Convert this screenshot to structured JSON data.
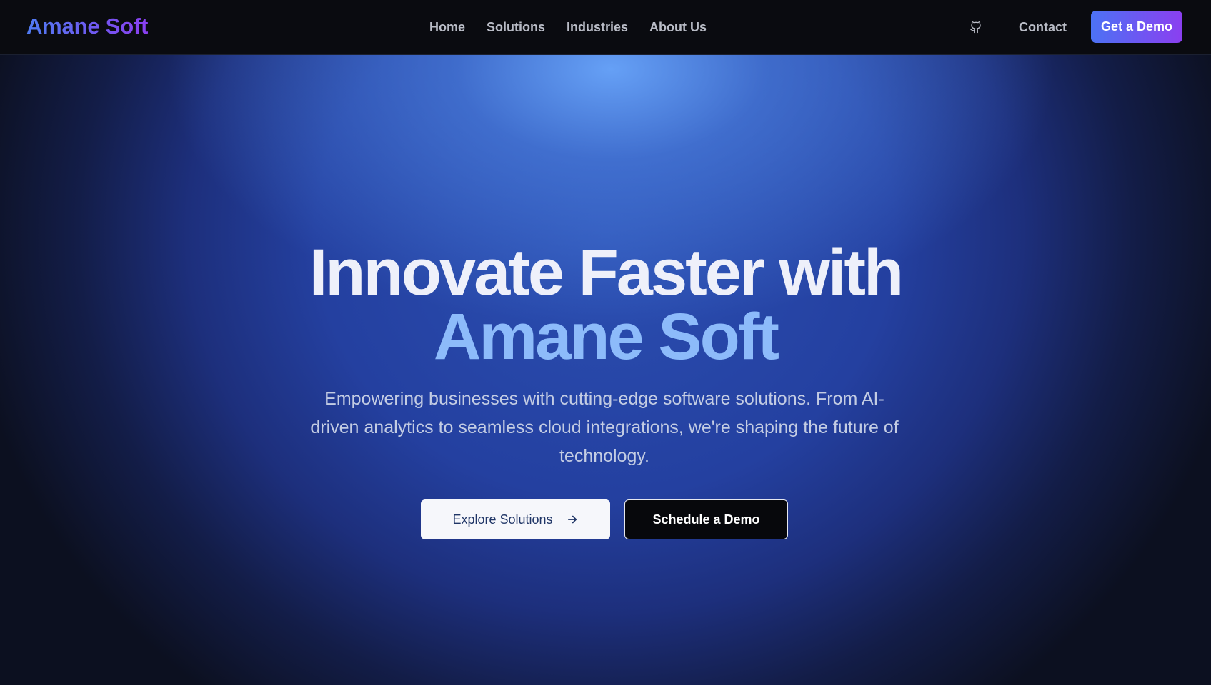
{
  "header": {
    "brand": "Amane Soft",
    "nav": [
      {
        "label": "Home"
      },
      {
        "label": "Solutions"
      },
      {
        "label": "Industries"
      },
      {
        "label": "About Us"
      }
    ],
    "github_icon": "github-icon",
    "contact_label": "Contact",
    "demo_button_label": "Get a Demo"
  },
  "hero": {
    "headline_line1": "Innovate Faster with",
    "headline_line2": "Amane Soft",
    "subtitle": "Empowering businesses with cutting-edge software solutions. From AI-driven analytics to seamless cloud integrations, we're shaping the future of technology.",
    "primary_button": "Explore Solutions",
    "primary_button_icon": "arrow-right-icon",
    "secondary_button": "Schedule a Demo"
  },
  "colors": {
    "brand_gradient_start": "#4f7cf2",
    "brand_gradient_end": "#8a3ff0",
    "accent_text": "#8dbbfa",
    "nav_background": "#0a0b10"
  }
}
